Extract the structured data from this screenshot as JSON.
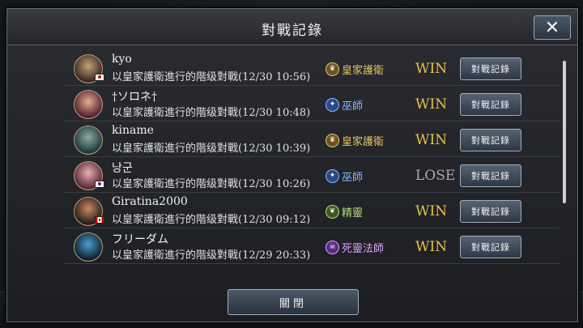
{
  "dialog": {
    "title": "對戰記錄",
    "close_icon": "close-icon",
    "close_label": "關閉"
  },
  "colors": {
    "win": "#e6c24a",
    "lose": "#a9a9a9",
    "royal_guard": "#e0c66a",
    "mage": "#8fb3ff",
    "elf": "#b9d97a",
    "necromancer": "#d7a3ff"
  },
  "rows": [
    {
      "name": "kyo",
      "desc": "以皇家護衛進行的階级對戰(12/30 10:56)",
      "class": "皇家護衛",
      "class_icon": "crown-icon",
      "class_color": "#e0c66a",
      "icon_bg": "#6a5420",
      "result": "WIN",
      "result_type": "win",
      "button": "對戰記錄",
      "flag": "jp",
      "avatar_colors": [
        "#3a2a24",
        "#c8a070"
      ]
    },
    {
      "name": "†ソロネ†",
      "desc": "以皇家護衛進行的階级對戰(12/30 10:48)",
      "class": "巫師",
      "class_icon": "wizard-icon",
      "class_color": "#8fb3ff",
      "icon_bg": "#284a8a",
      "result": "WIN",
      "result_type": "win",
      "button": "對戰記錄",
      "flag": "",
      "avatar_colors": [
        "#5a2030",
        "#e0b090"
      ]
    },
    {
      "name": "kiname",
      "desc": "以皇家護衛進行的階级對戰(12/30 10:39)",
      "class": "皇家護衛",
      "class_icon": "crown-icon",
      "class_color": "#e0c66a",
      "icon_bg": "#6a5420",
      "result": "WIN",
      "result_type": "win",
      "button": "對戰記錄",
      "flag": "",
      "avatar_colors": [
        "#1f3a40",
        "#8fa8a0"
      ]
    },
    {
      "name": "낭군",
      "desc": "以皇家護衛進行的階级對戰(12/30 10:26)",
      "class": "巫師",
      "class_icon": "wizard-icon",
      "class_color": "#8fb3ff",
      "icon_bg": "#284a8a",
      "result": "LOSE",
      "result_type": "lose",
      "button": "對戰記錄",
      "flag": "kr",
      "avatar_colors": [
        "#5a2a3a",
        "#e8b0b0"
      ]
    },
    {
      "name": "Giratina2000",
      "desc": "以皇家護衛進行的階级對戰(12/30 09:12)",
      "class": "精靈",
      "class_icon": "leaf-icon",
      "class_color": "#b9d97a",
      "icon_bg": "#3a5a20",
      "result": "WIN",
      "result_type": "win",
      "button": "對戰記錄",
      "flag": "ca",
      "avatar_colors": [
        "#2a1e1a",
        "#c88a60"
      ]
    },
    {
      "name": "フリーダム",
      "desc": "以皇家護衛進行的階级對戰(12/29 20:33)",
      "class": "死靈法師",
      "class_icon": "skull-icon",
      "class_color": "#d7a3ff",
      "icon_bg": "#5a2a80",
      "result": "WIN",
      "result_type": "win",
      "button": "對戰記錄",
      "flag": "",
      "avatar_colors": [
        "#102030",
        "#4aa0d0"
      ]
    }
  ]
}
